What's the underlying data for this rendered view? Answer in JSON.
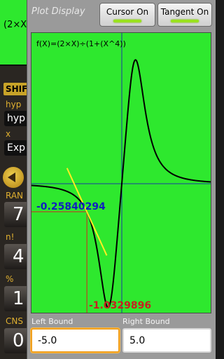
{
  "calculator": {
    "display_text": "(2×X)",
    "shift_label": "SHIF",
    "hyp_sup_label": "hyp",
    "hyp_key": "hyp",
    "xinv_label": "x",
    "exp_key": "Exp",
    "rand_label": "RAN",
    "key_7": "7",
    "factorial_label": "n!",
    "key_4": "4",
    "percent_label": "%",
    "key_1": "1",
    "cns_label": "CNS",
    "key_0": "0"
  },
  "dialog": {
    "title": "Plot Display",
    "cursor_button": "Cursor On",
    "tangent_button": "Tangent On",
    "left_bound_label": "Left Bound",
    "right_bound_label": "Right Bound",
    "left_bound_value": "-5.0",
    "right_bound_value": "5.0"
  },
  "plot": {
    "function_label": "f(X)=(2×X)÷(1+(X^4))",
    "cursor_y_value": "-0.25840294",
    "min_value": "-1.0329896",
    "x_range": [
      -5,
      5
    ],
    "colors": {
      "background": "#2ee82e",
      "curve": "#000000",
      "axis": "#1a3aa0",
      "cursor": "#d82020",
      "tangent": "#ffee22",
      "cursor_text": "#1020c0",
      "min_text": "#c82020"
    }
  }
}
